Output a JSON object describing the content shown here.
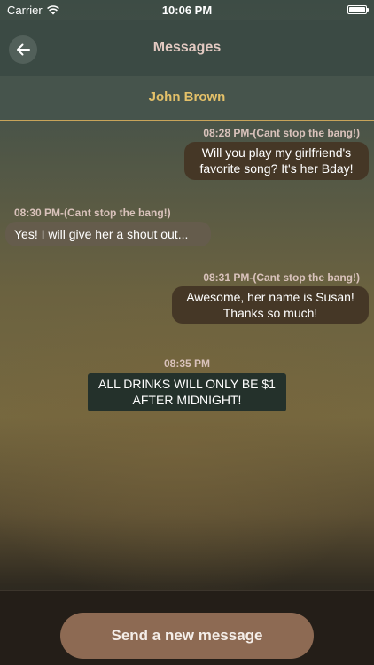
{
  "status_bar": {
    "carrier": "Carrier",
    "time": "10:06 PM"
  },
  "nav": {
    "title": "Messages",
    "back_icon": "arrow-left-icon"
  },
  "contact": {
    "name": "John Brown"
  },
  "messages": [
    {
      "direction": "outgoing",
      "time": "08:28 PM-(Cant stop the bang!)",
      "lines": [
        "Will you play my girlfriend's",
        "favorite song? It's her Bday!"
      ]
    },
    {
      "direction": "incoming",
      "time": "08:30 PM-(Cant stop the bang!)",
      "lines": [
        "Yes! I will give her a shout out..."
      ]
    },
    {
      "direction": "outgoing",
      "time": "08:31 PM-(Cant stop the bang!)",
      "lines": [
        "Awesome, her name is Susan!",
        "Thanks so much!"
      ]
    },
    {
      "direction": "broadcast",
      "time": "08:35 PM",
      "lines": [
        "ALL DRINKS WILL ONLY BE $1",
        "AFTER MIDNIGHT!"
      ]
    }
  ],
  "footer": {
    "send_label": "Send a new message"
  },
  "colors": {
    "accent_gold": "#c8a45a",
    "contact_name": "#e3c069",
    "send_button": "#8d6a53"
  }
}
